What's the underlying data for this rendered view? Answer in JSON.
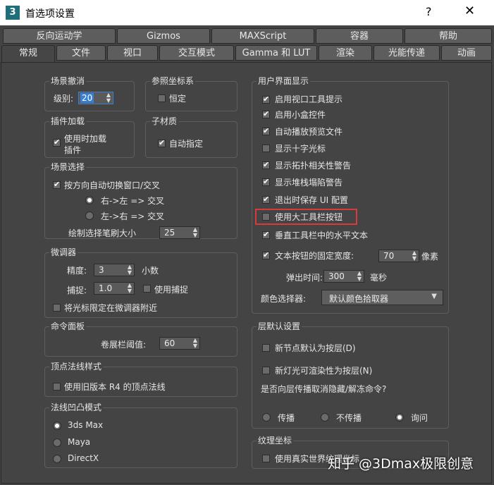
{
  "window": {
    "title": "首选项设置",
    "help": "?",
    "close": "✕",
    "app_icon": "3"
  },
  "tabs_row1": [
    "反向运动学",
    "Gizmos",
    "MAXScript",
    "容器",
    "帮助"
  ],
  "tabs_row2": [
    "常规",
    "文件",
    "视口",
    "交互模式",
    "Gamma 和 LUT",
    "渲染",
    "光能传递",
    "动画"
  ],
  "scene_undo": {
    "title": "场景撤消",
    "level_label": "级别:",
    "level_value": "20"
  },
  "ref_coord": {
    "title": "参照坐标系",
    "constant_label": "恒定",
    "constant_checked": false
  },
  "plugin_loading": {
    "title": "插件加载",
    "load_on_use_label": "使用时加载\n插件",
    "load_on_use_checked": true
  },
  "sub_material": {
    "title": "子材质",
    "auto_assign_label": "自动指定",
    "auto_assign_checked": true
  },
  "scene_selection": {
    "title": "场景选择",
    "auto_window_label": "按方向自动切换窗口/交叉",
    "auto_window_checked": true,
    "rtl_label": "右->左 => 交叉",
    "ltr_label": "左->右 => 交叉",
    "rtl_selected": true,
    "brush_size_label": "绘制选择笔刷大小",
    "brush_size_value": "25"
  },
  "spinners": {
    "title": "微调器",
    "precision_label": "精度:",
    "precision_value": "3",
    "decimals_label": "小数",
    "snap_label": "捕捉:",
    "snap_value": "1.0",
    "use_snap_label": "使用捕捉",
    "use_snap_checked": false,
    "confine_label": "将光标限定在微调器附近",
    "confine_checked": false
  },
  "command_panel": {
    "title": "命令面板",
    "rollout_label": "卷展栏阈值:",
    "rollout_value": "60"
  },
  "vertex_normal": {
    "title": "顶点法线样式",
    "legacy_label": "使用旧版本 R4 的顶点法线",
    "legacy_checked": false
  },
  "bump_mode": {
    "title": "法线凹凸模式",
    "options": [
      "3ds Max",
      "Maya",
      "DirectX"
    ],
    "selected": "3ds Max"
  },
  "ui_display": {
    "title": "用户界面显示",
    "items": [
      {
        "label": "启用视口工具提示",
        "checked": true
      },
      {
        "label": "启用小盒控件",
        "checked": true
      },
      {
        "label": "自动播放预览文件",
        "checked": true
      },
      {
        "label": "显示十字光标",
        "checked": false
      },
      {
        "label": "显示拓扑相关性警告",
        "checked": true
      },
      {
        "label": "显示堆栈塌陷警告",
        "checked": true
      },
      {
        "label": "退出时保存 UI 配置",
        "checked": true
      },
      {
        "label": "使用大工具栏按钮",
        "checked": false
      },
      {
        "label": "垂直工具栏中的水平文本",
        "checked": true
      }
    ],
    "fixed_width_label": "文本按钮的固定宽度:",
    "fixed_width_checked": true,
    "fixed_width_value": "70",
    "pixels_label": "像素",
    "flyout_label": "弹出时间:",
    "flyout_value": "300",
    "ms_label": "毫秒",
    "color_picker_label": "颜色选择器:",
    "color_picker_value": "默认颜色拾取器"
  },
  "layer_defaults": {
    "title": "层默认设置",
    "new_node_label": "新节点默认为按层(D)",
    "new_node_checked": false,
    "new_light_label": "新灯光可渲染性为按层(N)",
    "new_light_checked": false,
    "propagate_question": "是否向层传播取消隐藏/解冻命令?",
    "options": [
      "传播",
      "不传播",
      "询问"
    ],
    "selected": "询问"
  },
  "texture_coords": {
    "title": "纹理坐标",
    "real_world_label": "使用真实世界纹理坐标",
    "real_world_checked": false
  },
  "watermark": "知乎 @3Dmax极限创意",
  "colors": {
    "highlight_box": "#d83b3b",
    "focus_blue": "#3b7fd1"
  }
}
